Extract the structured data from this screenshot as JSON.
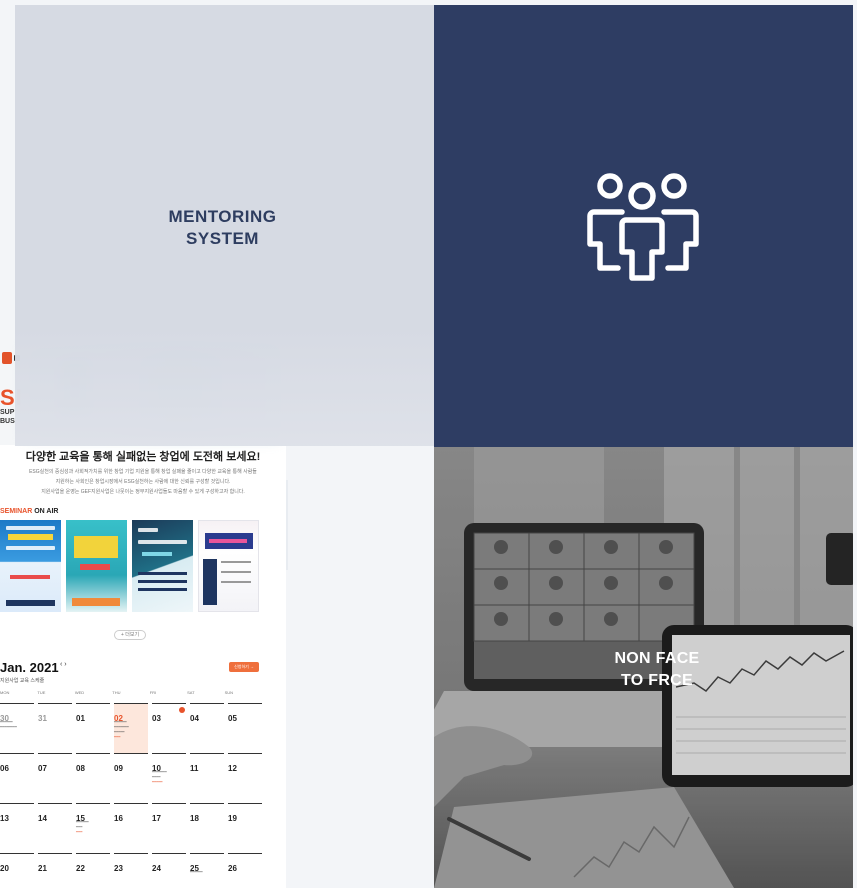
{
  "mentoring_panel": {
    "line1": "MENTORING",
    "line2": "SYSTEM"
  },
  "nonface_panel": {
    "line1": "NON FACE",
    "line2": "TO FRCE"
  },
  "website": {
    "hero_big": "SI",
    "hero_sub1": "SUP",
    "hero_sub2": "BUS",
    "headline": "다양한 교육을 통해 실패없는 창업에 도전해 보세요!",
    "description": [
      "ESG실천의 중심성과 사회적가치를 위한 창업 기업 지원을 통해 창업 실패율 줄이고 다양한 교육을 통해 사람들",
      "지원하는 사회인은 창업시장에서 ESG실천하는 사람에 대한 신뢰를 구성할 것입니다.",
      "지원사업을 운영는 GEF지원사업은 나뭇이는 정부지원사업들도 마음할 수 있게 구성하고자 합니다."
    ],
    "seminar_label": "SEMINAR",
    "seminar_on_air": " ON AIR",
    "more_button": "+ 더보기",
    "calendar": {
      "title": "Jan. 2021",
      "arrows": "‹  ›",
      "subtitle": "지원사업 교육 스케줄",
      "apply_button": "신청하기 →",
      "weekdays": [
        "MON",
        "TUE",
        "WED",
        "THU",
        "FRI",
        "SAT",
        "SUN"
      ],
      "rows": [
        [
          "30",
          "31",
          "01",
          "02",
          "03",
          "04",
          "05"
        ],
        [
          "06",
          "07",
          "08",
          "09",
          "10",
          "11",
          "12"
        ],
        [
          "13",
          "14",
          "15",
          "16",
          "17",
          "18",
          "19"
        ],
        [
          "20",
          "21",
          "22",
          "23",
          "24",
          "25",
          "26"
        ]
      ]
    }
  },
  "colors": {
    "navy": "#2e3d63",
    "grey_panel": "#d5d9e2",
    "accent_orange": "#e8532b"
  },
  "icons": {
    "team": "people-group-icon"
  }
}
